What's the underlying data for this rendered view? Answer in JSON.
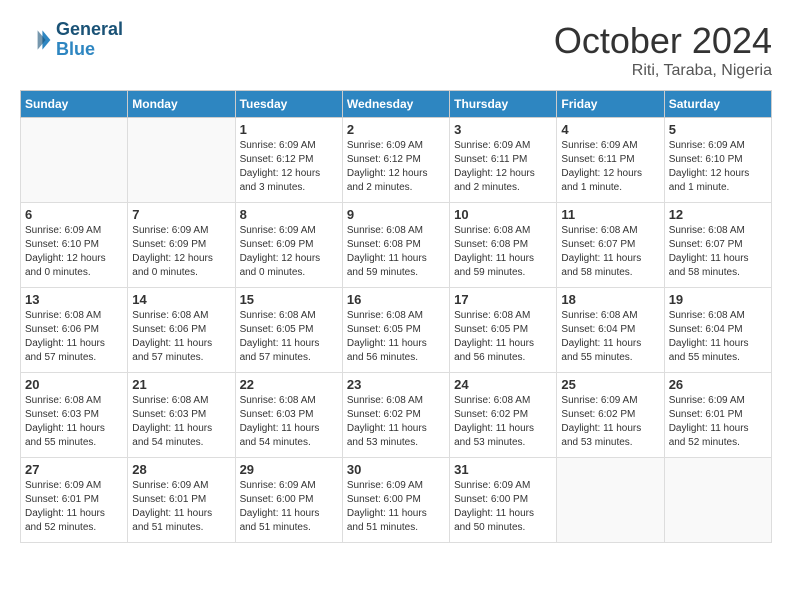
{
  "logo": {
    "line1": "General",
    "line2": "Blue"
  },
  "title": "October 2024",
  "location": "Riti, Taraba, Nigeria",
  "weekdays": [
    "Sunday",
    "Monday",
    "Tuesday",
    "Wednesday",
    "Thursday",
    "Friday",
    "Saturday"
  ],
  "weeks": [
    [
      {
        "day": "",
        "info": ""
      },
      {
        "day": "",
        "info": ""
      },
      {
        "day": "1",
        "info": "Sunrise: 6:09 AM\nSunset: 6:12 PM\nDaylight: 12 hours and 3 minutes."
      },
      {
        "day": "2",
        "info": "Sunrise: 6:09 AM\nSunset: 6:12 PM\nDaylight: 12 hours and 2 minutes."
      },
      {
        "day": "3",
        "info": "Sunrise: 6:09 AM\nSunset: 6:11 PM\nDaylight: 12 hours and 2 minutes."
      },
      {
        "day": "4",
        "info": "Sunrise: 6:09 AM\nSunset: 6:11 PM\nDaylight: 12 hours and 1 minute."
      },
      {
        "day": "5",
        "info": "Sunrise: 6:09 AM\nSunset: 6:10 PM\nDaylight: 12 hours and 1 minute."
      }
    ],
    [
      {
        "day": "6",
        "info": "Sunrise: 6:09 AM\nSunset: 6:10 PM\nDaylight: 12 hours and 0 minutes."
      },
      {
        "day": "7",
        "info": "Sunrise: 6:09 AM\nSunset: 6:09 PM\nDaylight: 12 hours and 0 minutes."
      },
      {
        "day": "8",
        "info": "Sunrise: 6:09 AM\nSunset: 6:09 PM\nDaylight: 12 hours and 0 minutes."
      },
      {
        "day": "9",
        "info": "Sunrise: 6:08 AM\nSunset: 6:08 PM\nDaylight: 11 hours and 59 minutes."
      },
      {
        "day": "10",
        "info": "Sunrise: 6:08 AM\nSunset: 6:08 PM\nDaylight: 11 hours and 59 minutes."
      },
      {
        "day": "11",
        "info": "Sunrise: 6:08 AM\nSunset: 6:07 PM\nDaylight: 11 hours and 58 minutes."
      },
      {
        "day": "12",
        "info": "Sunrise: 6:08 AM\nSunset: 6:07 PM\nDaylight: 11 hours and 58 minutes."
      }
    ],
    [
      {
        "day": "13",
        "info": "Sunrise: 6:08 AM\nSunset: 6:06 PM\nDaylight: 11 hours and 57 minutes."
      },
      {
        "day": "14",
        "info": "Sunrise: 6:08 AM\nSunset: 6:06 PM\nDaylight: 11 hours and 57 minutes."
      },
      {
        "day": "15",
        "info": "Sunrise: 6:08 AM\nSunset: 6:05 PM\nDaylight: 11 hours and 57 minutes."
      },
      {
        "day": "16",
        "info": "Sunrise: 6:08 AM\nSunset: 6:05 PM\nDaylight: 11 hours and 56 minutes."
      },
      {
        "day": "17",
        "info": "Sunrise: 6:08 AM\nSunset: 6:05 PM\nDaylight: 11 hours and 56 minutes."
      },
      {
        "day": "18",
        "info": "Sunrise: 6:08 AM\nSunset: 6:04 PM\nDaylight: 11 hours and 55 minutes."
      },
      {
        "day": "19",
        "info": "Sunrise: 6:08 AM\nSunset: 6:04 PM\nDaylight: 11 hours and 55 minutes."
      }
    ],
    [
      {
        "day": "20",
        "info": "Sunrise: 6:08 AM\nSunset: 6:03 PM\nDaylight: 11 hours and 55 minutes."
      },
      {
        "day": "21",
        "info": "Sunrise: 6:08 AM\nSunset: 6:03 PM\nDaylight: 11 hours and 54 minutes."
      },
      {
        "day": "22",
        "info": "Sunrise: 6:08 AM\nSunset: 6:03 PM\nDaylight: 11 hours and 54 minutes."
      },
      {
        "day": "23",
        "info": "Sunrise: 6:08 AM\nSunset: 6:02 PM\nDaylight: 11 hours and 53 minutes."
      },
      {
        "day": "24",
        "info": "Sunrise: 6:08 AM\nSunset: 6:02 PM\nDaylight: 11 hours and 53 minutes."
      },
      {
        "day": "25",
        "info": "Sunrise: 6:09 AM\nSunset: 6:02 PM\nDaylight: 11 hours and 53 minutes."
      },
      {
        "day": "26",
        "info": "Sunrise: 6:09 AM\nSunset: 6:01 PM\nDaylight: 11 hours and 52 minutes."
      }
    ],
    [
      {
        "day": "27",
        "info": "Sunrise: 6:09 AM\nSunset: 6:01 PM\nDaylight: 11 hours and 52 minutes."
      },
      {
        "day": "28",
        "info": "Sunrise: 6:09 AM\nSunset: 6:01 PM\nDaylight: 11 hours and 51 minutes."
      },
      {
        "day": "29",
        "info": "Sunrise: 6:09 AM\nSunset: 6:00 PM\nDaylight: 11 hours and 51 minutes."
      },
      {
        "day": "30",
        "info": "Sunrise: 6:09 AM\nSunset: 6:00 PM\nDaylight: 11 hours and 51 minutes."
      },
      {
        "day": "31",
        "info": "Sunrise: 6:09 AM\nSunset: 6:00 PM\nDaylight: 11 hours and 50 minutes."
      },
      {
        "day": "",
        "info": ""
      },
      {
        "day": "",
        "info": ""
      }
    ]
  ]
}
